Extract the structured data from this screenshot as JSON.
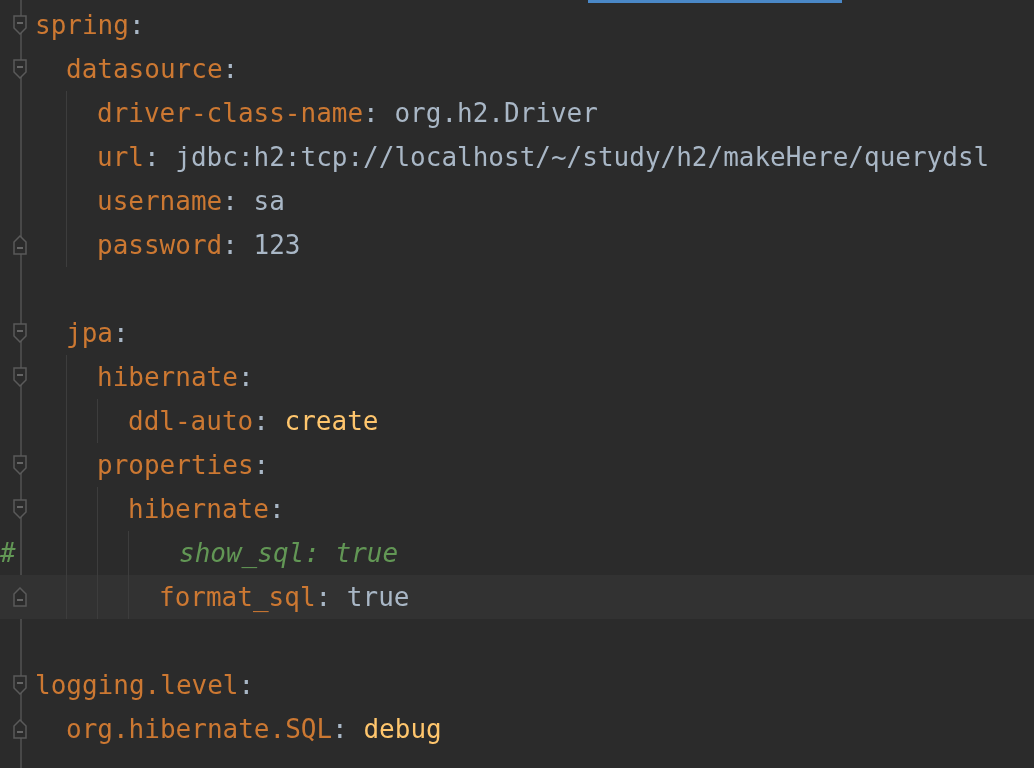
{
  "editor_tab": {
    "selected": true
  },
  "yaml": [
    {
      "kind": "node",
      "key": "spring",
      "colon": ":",
      "expanded": true,
      "current": false,
      "children": [
        {
          "kind": "node",
          "key": "datasource",
          "colon": ":",
          "expanded": true,
          "current": false,
          "children": [
            {
              "kind": "pair",
              "key": "driver-class-name",
              "colon": ":",
              "value": "org.h2.Driver",
              "keyword": false,
              "fold_end": false,
              "current": false
            },
            {
              "kind": "pair",
              "key": "url",
              "colon": ":",
              "value": "jdbc:h2:tcp://localhost/~/study/h2/makeHere/querydsl",
              "keyword": false,
              "fold_end": false,
              "current": false
            },
            {
              "kind": "pair",
              "key": "username",
              "colon": ":",
              "value": "sa",
              "keyword": false,
              "fold_end": false,
              "current": false
            },
            {
              "kind": "pair",
              "key": "password",
              "colon": ":",
              "value": "123",
              "keyword": false,
              "fold_end": true,
              "current": false
            }
          ]
        },
        {
          "kind": "blank"
        },
        {
          "kind": "node",
          "key": "jpa",
          "colon": ":",
          "expanded": true,
          "current": false,
          "children": [
            {
              "kind": "node",
              "key": "hibernate",
              "colon": ":",
              "expanded": true,
              "current": false,
              "children": [
                {
                  "kind": "pair",
                  "key": "ddl-auto",
                  "colon": ":",
                  "value": "create",
                  "keyword": true,
                  "fold_end": false,
                  "current": false
                }
              ]
            },
            {
              "kind": "node",
              "key": "properties",
              "colon": ":",
              "expanded": true,
              "current": false,
              "children": [
                {
                  "kind": "node",
                  "key": "hibernate",
                  "colon": ":",
                  "expanded": true,
                  "current": false,
                  "children": [
                    {
                      "kind": "comment",
                      "marker": "#",
                      "text": "show_sql: true"
                    },
                    {
                      "kind": "pair",
                      "key": "format_sql",
                      "colon": ":",
                      "value": "true",
                      "keyword": false,
                      "fold_end": true,
                      "current": true
                    }
                  ]
                }
              ]
            }
          ]
        }
      ]
    },
    {
      "kind": "blank"
    },
    {
      "kind": "node",
      "key": "logging.level",
      "colon": ":",
      "expanded": true,
      "current": false,
      "children": [
        {
          "kind": "pair",
          "key": "org.hibernate.SQL",
          "colon": ":",
          "value": "debug",
          "keyword": true,
          "fold_end": true,
          "current": false
        }
      ]
    }
  ]
}
